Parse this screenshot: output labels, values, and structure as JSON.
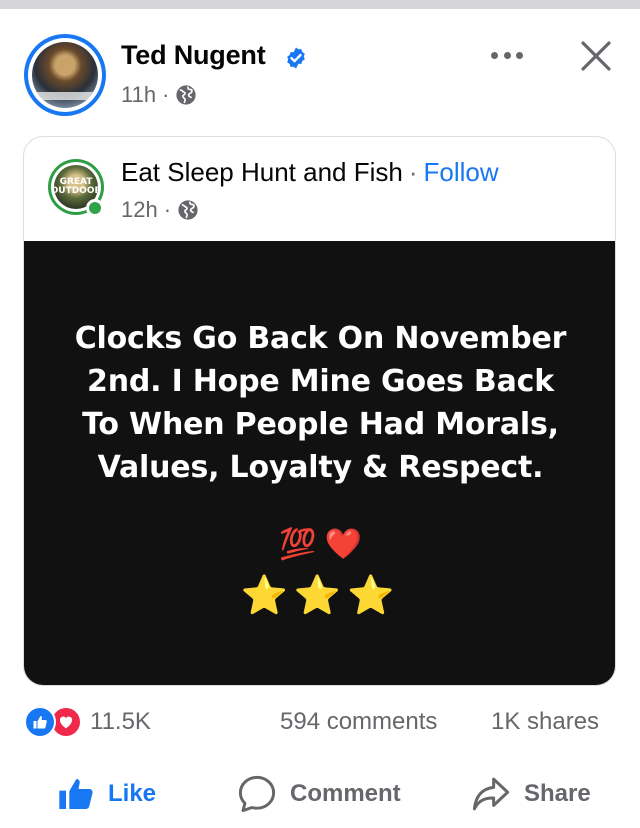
{
  "post": {
    "author": "Ted Nugent",
    "time": "11h",
    "separator": "·"
  },
  "shared": {
    "page_name": "Eat Sleep Hunt and Fish",
    "separator": "·",
    "follow_label": "Follow",
    "time": "12h",
    "avatar_text": "GREAT OUTDOOR",
    "image_text": "Clocks Go Back On November 2nd. I Hope Mine Goes Back To When People Had Morals, Values, Loyalty & Respect.",
    "emoji_line_1": "💯 ❤️",
    "emoji_line_2": "⭐⭐⭐"
  },
  "stats": {
    "reactions": "11.5K",
    "comments": "594 comments",
    "shares": "1K shares"
  },
  "actions": {
    "like": "Like",
    "comment": "Comment",
    "share": "Share"
  },
  "colors": {
    "brand_blue": "#1877f2",
    "secondary_text": "#65676b",
    "love_red": "#f02849",
    "online_green": "#31a24c",
    "image_background": "#111111"
  },
  "icons": [
    "verified-badge-icon",
    "globe-icon",
    "more-options-icon",
    "close-icon",
    "like-reaction-icon",
    "love-reaction-icon",
    "thumbs-up-icon",
    "comment-bubble-icon",
    "share-arrow-icon"
  ]
}
